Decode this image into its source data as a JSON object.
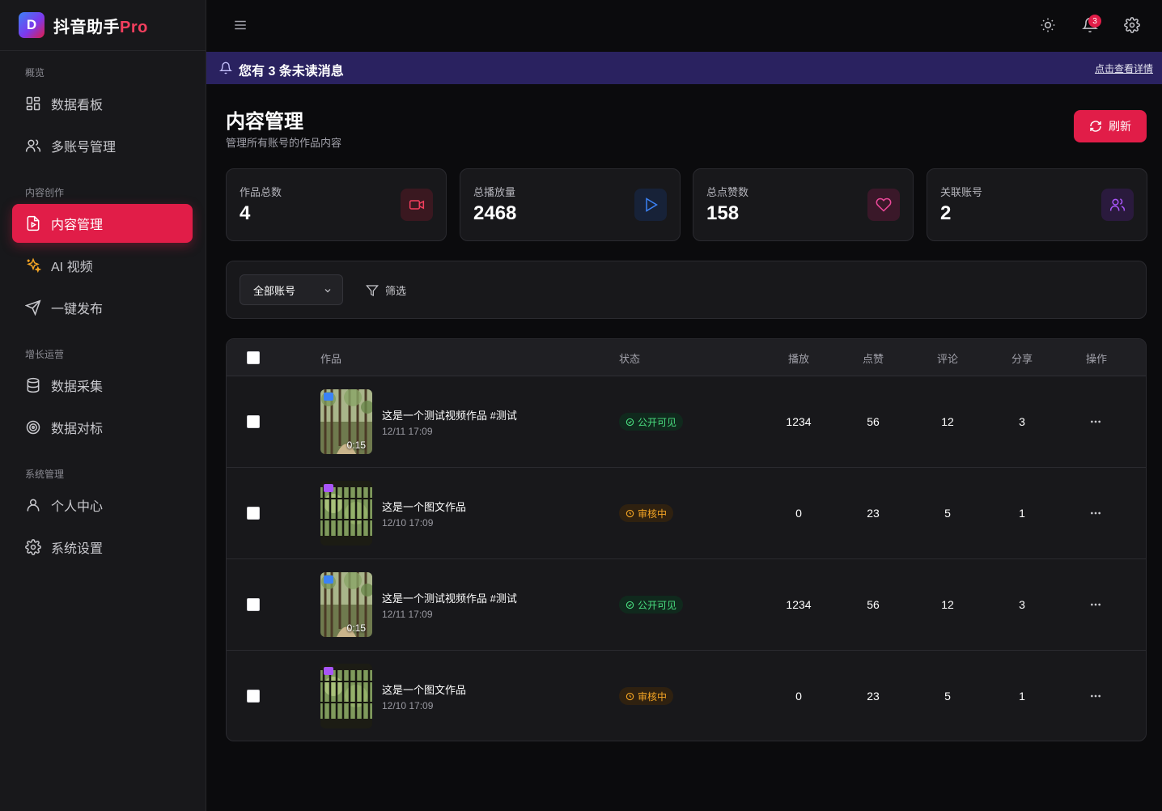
{
  "brand": {
    "logo_letter": "D",
    "name": "抖音助手",
    "suffix": "Pro"
  },
  "sidebar": {
    "sections": [
      {
        "label": "概览"
      },
      {
        "label": "内容创作"
      },
      {
        "label": "增长运营"
      },
      {
        "label": "系统管理"
      }
    ],
    "items": [
      {
        "label": "数据看板",
        "icon": "dashboard-icon"
      },
      {
        "label": "多账号管理",
        "icon": "users-icon"
      },
      {
        "label": "内容管理",
        "icon": "file-video-icon",
        "active": true
      },
      {
        "label": "AI 视频",
        "icon": "sparkles-icon"
      },
      {
        "label": "一键发布",
        "icon": "send-icon"
      },
      {
        "label": "数据采集",
        "icon": "database-icon"
      },
      {
        "label": "数据对标",
        "icon": "target-icon"
      },
      {
        "label": "个人中心",
        "icon": "user-icon"
      },
      {
        "label": "系统设置",
        "icon": "gear-icon"
      }
    ]
  },
  "topbar": {
    "notification_count": "3"
  },
  "banner": {
    "text": "您有 3 条未读消息",
    "link": "点击查看详情"
  },
  "page": {
    "title": "内容管理",
    "subtitle": "管理所有账号的作品内容",
    "refresh_label": "刷新"
  },
  "stats": [
    {
      "label": "作品总数",
      "value": "4",
      "icon": "video-camera-icon",
      "color": "#f43f5e"
    },
    {
      "label": "总播放量",
      "value": "2468",
      "icon": "play-icon",
      "color": "#3b82f6"
    },
    {
      "label": "总点赞数",
      "value": "158",
      "icon": "heart-icon",
      "color": "#ec4899"
    },
    {
      "label": "关联账号",
      "value": "2",
      "icon": "users-icon",
      "color": "#a855f7"
    }
  ],
  "filters": {
    "account_select": "全部账号",
    "filter_label": "筛选"
  },
  "table": {
    "columns": {
      "work": "作品",
      "status": "状态",
      "plays": "播放",
      "likes": "点赞",
      "comments": "评论",
      "shares": "分享",
      "actions": "操作"
    },
    "rows": [
      {
        "title": "这是一个测试视频作品 #测试",
        "date": "12/11 17:09",
        "type": "video",
        "duration": "0:15",
        "status": "公开可见",
        "status_kind": "public",
        "plays": "1234",
        "likes": "56",
        "comments": "12",
        "shares": "3"
      },
      {
        "title": "这是一个图文作品",
        "date": "12/10 17:09",
        "type": "image",
        "duration": "",
        "status": "审核中",
        "status_kind": "review",
        "plays": "0",
        "likes": "23",
        "comments": "5",
        "shares": "1"
      },
      {
        "title": "这是一个测试视频作品 #测试",
        "date": "12/11 17:09",
        "type": "video",
        "duration": "0:15",
        "status": "公开可见",
        "status_kind": "public",
        "plays": "1234",
        "likes": "56",
        "comments": "12",
        "shares": "3"
      },
      {
        "title": "这是一个图文作品",
        "date": "12/10 17:09",
        "type": "image",
        "duration": "",
        "status": "审核中",
        "status_kind": "review",
        "plays": "0",
        "likes": "23",
        "comments": "5",
        "shares": "1"
      }
    ]
  }
}
